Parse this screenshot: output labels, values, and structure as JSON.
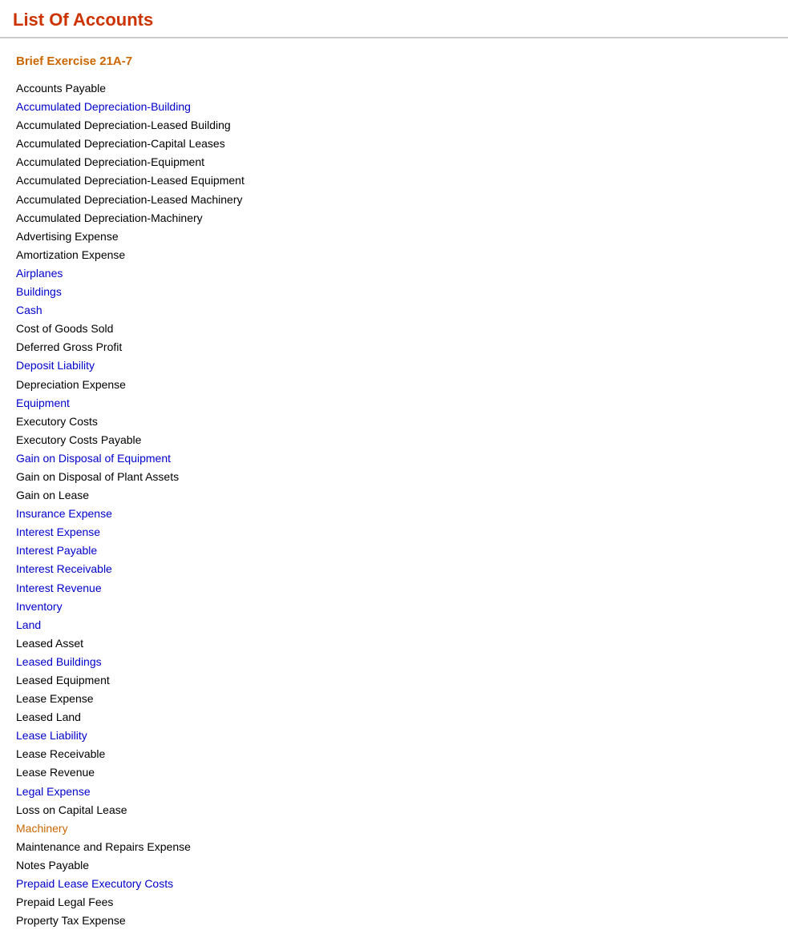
{
  "page": {
    "title": "List Of Accounts"
  },
  "section": {
    "title": "Brief Exercise 21A-7"
  },
  "accounts": [
    {
      "name": "Accounts Payable",
      "color": "black"
    },
    {
      "name": "Accumulated Depreciation-Building",
      "color": "blue"
    },
    {
      "name": "Accumulated Depreciation-Leased Building",
      "color": "black"
    },
    {
      "name": "Accumulated Depreciation-Capital Leases",
      "color": "black"
    },
    {
      "name": "Accumulated Depreciation-Equipment",
      "color": "black"
    },
    {
      "name": "Accumulated Depreciation-Leased Equipment",
      "color": "black"
    },
    {
      "name": "Accumulated Depreciation-Leased Machinery",
      "color": "black"
    },
    {
      "name": "Accumulated Depreciation-Machinery",
      "color": "black"
    },
    {
      "name": "Advertising Expense",
      "color": "black"
    },
    {
      "name": "Amortization Expense",
      "color": "black"
    },
    {
      "name": "Airplanes",
      "color": "blue"
    },
    {
      "name": "Buildings",
      "color": "blue"
    },
    {
      "name": "Cash",
      "color": "blue"
    },
    {
      "name": "Cost of Goods Sold",
      "color": "black"
    },
    {
      "name": "Deferred Gross Profit",
      "color": "black"
    },
    {
      "name": "Deposit Liability",
      "color": "blue"
    },
    {
      "name": "Depreciation Expense",
      "color": "black"
    },
    {
      "name": "Equipment",
      "color": "blue"
    },
    {
      "name": "Executory Costs",
      "color": "black"
    },
    {
      "name": "Executory Costs Payable",
      "color": "black"
    },
    {
      "name": "Gain on Disposal of Equipment",
      "color": "blue"
    },
    {
      "name": "Gain on Disposal of Plant Assets",
      "color": "black"
    },
    {
      "name": "Gain on Lease",
      "color": "black"
    },
    {
      "name": "Insurance Expense",
      "color": "blue"
    },
    {
      "name": "Interest Expense",
      "color": "blue"
    },
    {
      "name": "Interest Payable",
      "color": "blue"
    },
    {
      "name": "Interest Receivable",
      "color": "blue"
    },
    {
      "name": "Interest Revenue",
      "color": "blue"
    },
    {
      "name": "Inventory",
      "color": "blue"
    },
    {
      "name": "Land",
      "color": "blue"
    },
    {
      "name": "Leased Asset",
      "color": "black"
    },
    {
      "name": "Leased Buildings",
      "color": "blue"
    },
    {
      "name": "Leased Equipment",
      "color": "black"
    },
    {
      "name": "Lease Expense",
      "color": "black"
    },
    {
      "name": "Leased Land",
      "color": "black"
    },
    {
      "name": "Lease Liability",
      "color": "blue"
    },
    {
      "name": "Lease Receivable",
      "color": "black"
    },
    {
      "name": "Lease Revenue",
      "color": "black"
    },
    {
      "name": "Legal Expense",
      "color": "blue"
    },
    {
      "name": "Loss on Capital Lease",
      "color": "black"
    },
    {
      "name": "Machinery",
      "color": "orange"
    },
    {
      "name": "Maintenance and Repairs Expense",
      "color": "black"
    },
    {
      "name": "Notes Payable",
      "color": "black"
    },
    {
      "name": "Prepaid Lease Executory Costs",
      "color": "blue"
    },
    {
      "name": "Prepaid Legal Fees",
      "color": "black"
    },
    {
      "name": "Property Tax Expense",
      "color": "black"
    }
  ]
}
